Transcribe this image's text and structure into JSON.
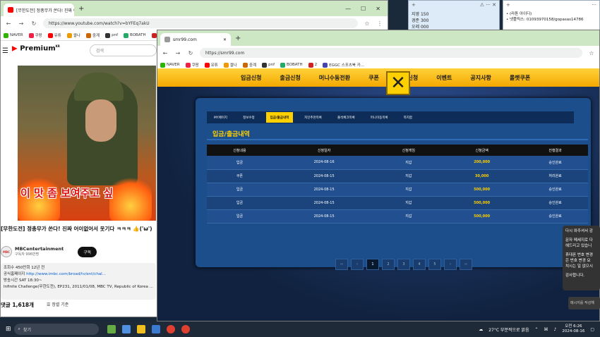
{
  "youtube_window": {
    "tab_title": "[무한도전] 정총무가 쏜다! 진짜 어이없어서 웃기다 ㅋㅋㅋ",
    "url": "https://www.youtube.com/watch?v=bYFEq7akU",
    "bookmarks": [
      "NAVER",
      "쿠팡",
      "유튜",
      "쌀나",
      "중계",
      "pnf",
      "BOBATH",
      "2"
    ],
    "logo": "Premium",
    "logo_superscript": "KR",
    "search_placeholder": "검색",
    "video_caption": "이 맛 좀 보여주고 싶",
    "video_title": "[무한도전] 정총무가 쏜다! 진짜 어이없어서 웃기다 ㅋㅋㅋ 👍('ω')",
    "channel_name": "MBCentertainment",
    "subscribers": "구독자 996만명",
    "subscribe_label": "구독",
    "avatar_label": "MBC",
    "desc_line1": "조회수 450만회  12년 전",
    "desc_line2_prefix": "공식홈페이지 ",
    "desc_link": "http://www.imbc.com/broad/tv/ent/chal...",
    "desc_line3": "방송시간  SAT 18:30~",
    "desc_line4": "Infinite Challenge(무한도전), EP231, 2011/01/08, MBC TV, Republic of Korea ...",
    "comments": "댓글 1,618개",
    "sort_label": "정렬 기준"
  },
  "note1": {
    "lines": [
      "지영 150",
      "경준 300",
      "오레 000"
    ]
  },
  "note2": {
    "lines": [
      "• (라톤 아이디)",
      "• 넷플릭스: 01093970158/gopasas14786"
    ]
  },
  "site_window": {
    "tab_title": "smr99.com",
    "url": "https://smr99.com",
    "bookmarks": [
      "NAVER",
      "쿠팡",
      "유튜",
      "쌀나",
      "중계",
      "pnf",
      "BOBATH",
      "2",
      "EGGC 스포츠북 카..."
    ],
    "menu": [
      "입금신청",
      "출금신청",
      "머니수동전환",
      "쿠폰",
      "콤프신청",
      "이벤트",
      "공지사항",
      "롤렛쿠폰"
    ],
    "subtabs": [
      "MY페이지",
      "정보수정",
      "입금/출금내역",
      "지인추천목록",
      "출석체크목록",
      "머니이동목록",
      "쪽지함"
    ],
    "active_subtab": 2,
    "panel_title": "입금/출금내역",
    "columns": [
      "신청내용",
      "신청일자",
      "신청게임",
      "신청금액",
      "진행결과"
    ],
    "rows": [
      [
        "입금",
        "2024-08-16",
        "지갑",
        "200,000",
        "승인완료"
      ],
      [
        "쿠폰",
        "2024-08-15",
        "지갑",
        "30,000",
        "처리완료"
      ],
      [
        "입금",
        "2024-08-15",
        "지갑",
        "500,000",
        "승인완료"
      ],
      [
        "입금",
        "2024-08-15",
        "지갑",
        "500,000",
        "승인완료"
      ],
      [
        "입금",
        "2024-08-15",
        "지갑",
        "500,000",
        "승인완료"
      ]
    ],
    "pager": [
      "‹‹",
      "‹",
      "1",
      "2",
      "3",
      "4",
      "5",
      "›",
      "››"
    ],
    "current_page": "1",
    "chat_lines": [
      "다시 와주셔서 감",
      "문자 메세지로 다",
      "헤드리고 있습니",
      "휴대폰 번호 변경",
      "은 번호 변경 요",
      "치시는 일 없으시",
      "감사합니다."
    ],
    "chat_placeholder": "메시지를 작성해"
  },
  "taskbar": {
    "search_placeholder": "찾기",
    "weather": "27°C  부분적으로 맑음",
    "time": "오전 6:26",
    "date": "2024-08-16"
  },
  "colors": {
    "accent": "#ffd000",
    "panel": "#1c4e8c"
  }
}
